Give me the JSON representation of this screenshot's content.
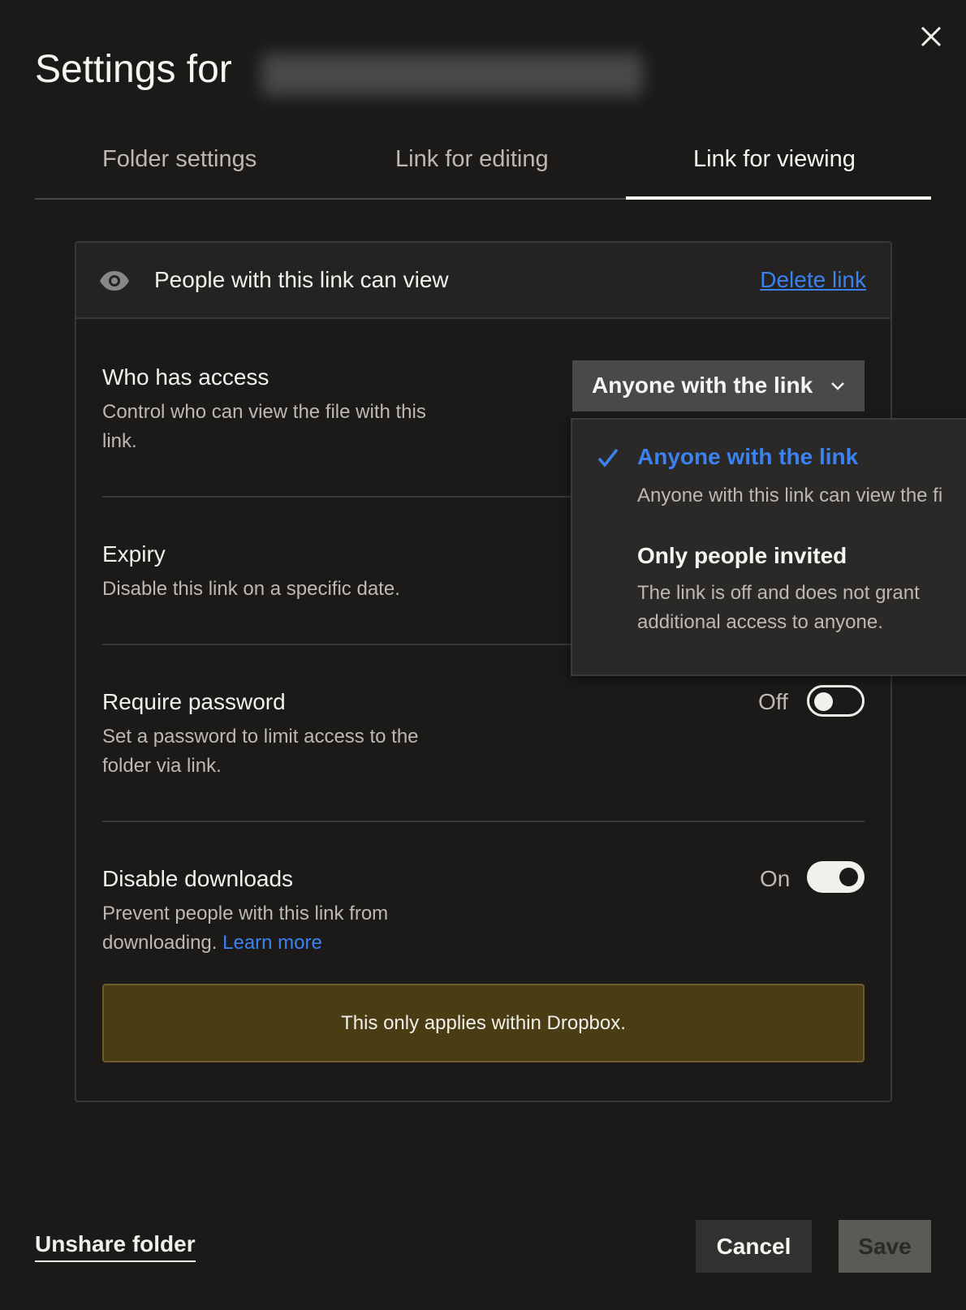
{
  "dialog": {
    "title": "Settings for",
    "close_icon": "close-icon"
  },
  "tabs": [
    {
      "label": "Folder settings"
    },
    {
      "label": "Link for editing"
    },
    {
      "label": "Link for viewing",
      "active": true
    }
  ],
  "link_header": {
    "icon": "eye-icon",
    "label": "People with this link can view",
    "delete_label": "Delete link"
  },
  "access": {
    "title": "Who has access",
    "description": "Control who can view the file with this link.",
    "selected": "Anyone with the link",
    "options": [
      {
        "label": "Anyone with the link",
        "description": "Anyone with this link can view the fi",
        "selected": true
      },
      {
        "label": "Only people invited",
        "description": "The link is off and does not grant additional access to anyone.",
        "selected": false
      }
    ]
  },
  "expiry": {
    "title": "Expiry",
    "description": "Disable this link on a specific date."
  },
  "password": {
    "title": "Require password",
    "description": "Set a password to limit access to the folder via link.",
    "state_label": "Off",
    "on": false
  },
  "downloads": {
    "title": "Disable downloads",
    "description": "Prevent people with this link from downloading.",
    "learn_more": "Learn more",
    "state_label": "On",
    "on": true,
    "notice": "This only applies within Dropbox."
  },
  "footer": {
    "unshare": "Unshare folder",
    "cancel": "Cancel",
    "save": "Save"
  },
  "colors": {
    "accent": "#3b82f0",
    "notice_bg": "#4a3d14",
    "background": "#1b1a19"
  }
}
